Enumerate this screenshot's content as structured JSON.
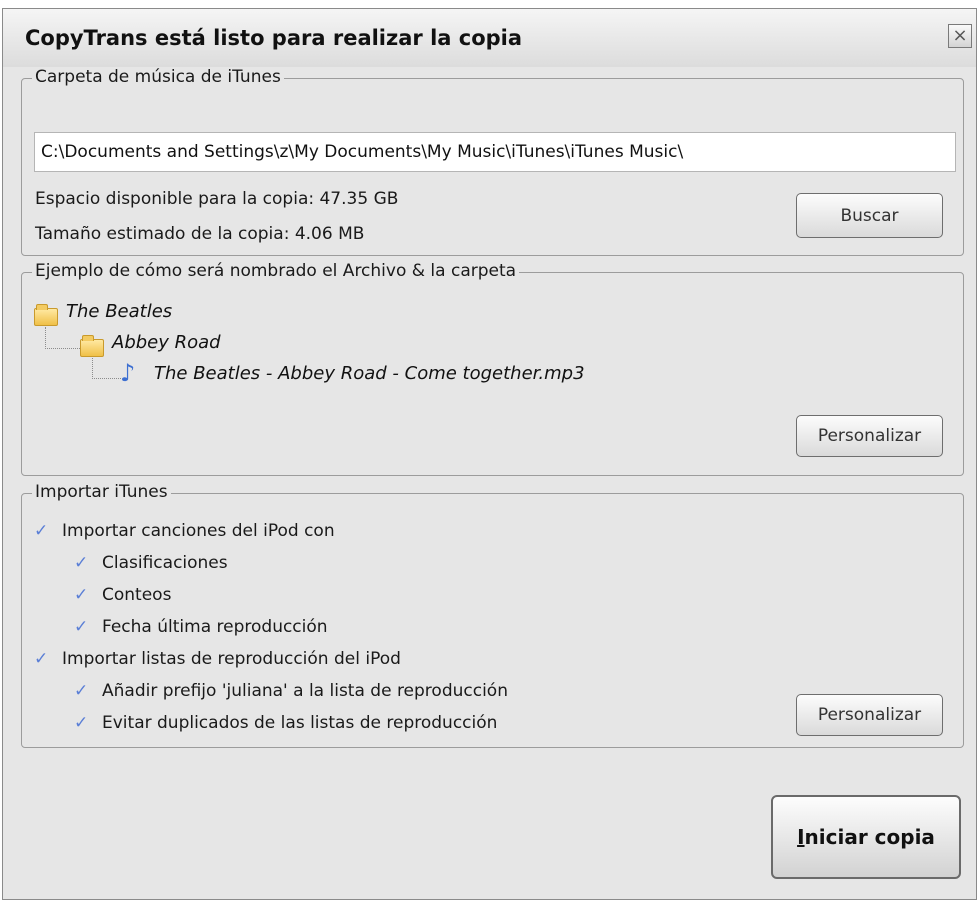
{
  "window": {
    "title": "CopyTrans está listo para realizar la copia",
    "close_label": "×"
  },
  "music_folder": {
    "legend": "Carpeta de música de iTunes",
    "path": "C:\\Documents and Settings\\z\\My Documents\\My Music\\iTunes\\iTunes Music\\",
    "available_space": "Espacio disponible para la copia: 47.35 GB",
    "estimated_size": "Tamaño estimado de la copia: 4.06 MB",
    "browse_label": "Buscar"
  },
  "naming_example": {
    "legend": "Ejemplo de cómo será nombrado el Archivo & la carpeta",
    "artist_folder": "The Beatles",
    "album_folder": "Abbey Road",
    "file_name": "The Beatles - Abbey Road - Come together.mp3",
    "customize_label": "Personalizar",
    "icons": [
      "folder-icon",
      "music-note-icon"
    ]
  },
  "import_itunes": {
    "legend": "Importar iTunes",
    "options": [
      {
        "label": "Importar canciones del iPod con",
        "checked": true,
        "level": 0
      },
      {
        "label": "Clasificaciones",
        "checked": true,
        "level": 1
      },
      {
        "label": "Conteos",
        "checked": true,
        "level": 1
      },
      {
        "label": "Fecha última reproducción",
        "checked": true,
        "level": 1
      },
      {
        "label": "Importar listas de reproducción del iPod",
        "checked": true,
        "level": 0
      },
      {
        "label": "Añadir prefijo 'juliana' a la lista de reproducción",
        "checked": true,
        "level": 1
      },
      {
        "label": "Evitar duplicados de las listas de reproducción",
        "checked": true,
        "level": 1
      }
    ],
    "customize_label": "Personalizar",
    "check_glyph": "✓"
  },
  "start": {
    "accel": "I",
    "rest": "niciar copia"
  },
  "colors": {
    "check": "#5b7fd6",
    "music_note": "#3d6fd1",
    "folder": "#f0c048"
  }
}
